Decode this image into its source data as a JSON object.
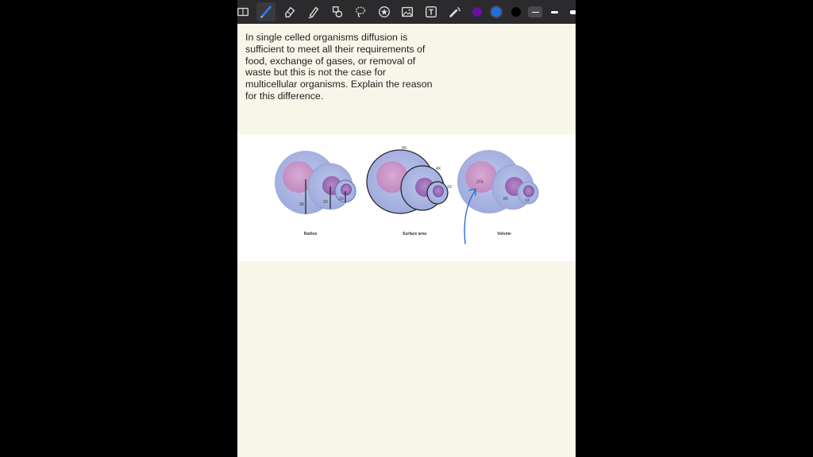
{
  "toolbar": {
    "tools": [
      "notebook-icon",
      "pen-icon",
      "eraser-icon",
      "highlighter-icon",
      "shapes-icon",
      "lasso-icon",
      "star-sticker-icon",
      "image-icon",
      "text-box-icon",
      "laser-pointer-icon"
    ],
    "colors": [
      "#6a0fa0",
      "#1e6fe0",
      "#000000"
    ],
    "selected_color": "#1e6fe0",
    "accent": "#1e6fe0"
  },
  "question": {
    "text": "In single celled organisms diffusion is sufficient to meet all their requirements of food, exchange of gases, or removal of waste but this is not the case for multicellular organisms. Explain the reason for this difference."
  },
  "figure": {
    "panels": [
      {
        "label": "Radius",
        "markers": [
          "3X",
          "2X",
          "1X"
        ]
      },
      {
        "label": "Surface area",
        "markers": [
          "9X",
          "4X",
          "1X"
        ]
      },
      {
        "label": "Volume",
        "markers": [
          "27X",
          "8X",
          "1X"
        ]
      }
    ]
  }
}
